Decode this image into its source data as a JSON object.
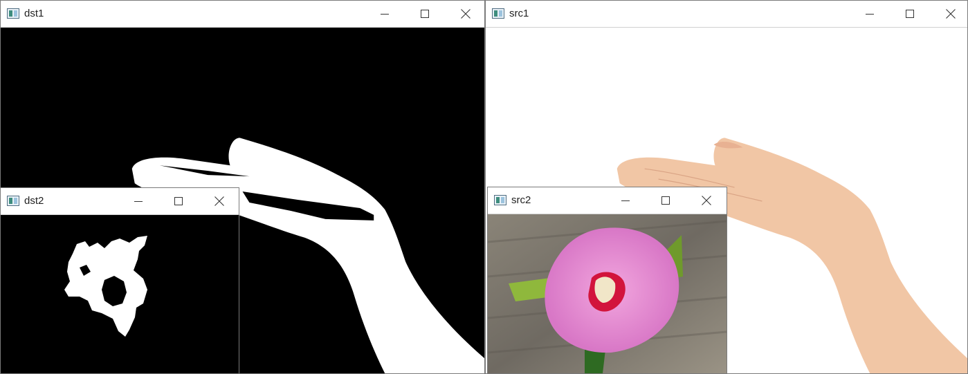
{
  "windows": {
    "dst1": {
      "title": "dst1"
    },
    "src1": {
      "title": "src1"
    },
    "dst2": {
      "title": "dst2"
    },
    "src2": {
      "title": "src2"
    }
  },
  "icons": {
    "app": "opencv-window-icon",
    "minimize": "minimize-icon",
    "maximize": "maximize-icon",
    "close": "close-icon"
  },
  "colors": {
    "mask_background": "#000000",
    "mask_foreground": "#ffffff",
    "petal": "#e48ad0",
    "flower_center": "#d2143c",
    "skin": "#f1c6a5"
  }
}
